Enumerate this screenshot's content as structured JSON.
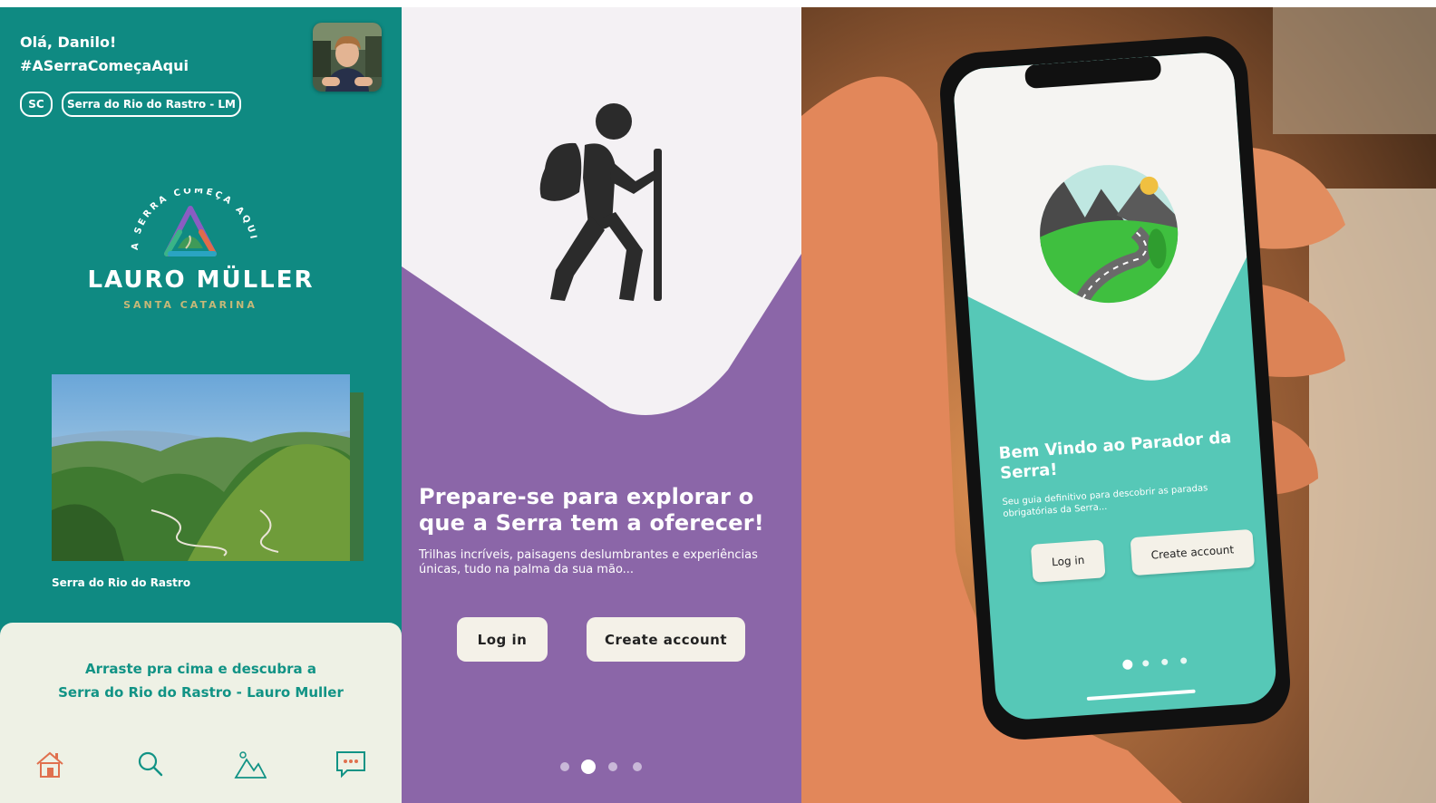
{
  "panel1": {
    "greeting": "Olá, Danilo!",
    "hashtag": "#ASerraComeçaAqui",
    "state_chip": "SC",
    "location_chip": "Serra do Rio do Rastro - LM",
    "logo": {
      "arc_text": "A SERRA COMEÇA AQUI",
      "name": "LAURO MÜLLER",
      "subtitle": "SANTA CATARINA"
    },
    "photo_caption": "Serra do Rio do Rastro",
    "sheet_line1": "Arraste pra cima e descubra a",
    "sheet_line2": "Serra do Rio do Rastro - Lauro Muller",
    "nav_icons": [
      "cabin-icon",
      "search-icon",
      "mountains-sun-icon",
      "chat-icon"
    ]
  },
  "panel2": {
    "title": "Prepare-se para explorar o que a Serra tem a oferecer!",
    "subtitle": "Trilhas incríveis, paisagens deslumbrantes e experiências únicas, tudo na palma da sua mão...",
    "login_label": "Log in",
    "create_label": "Create account",
    "active_dot": 1
  },
  "panel3": {
    "title": "Bem Vindo ao Parador da Serra!",
    "subtitle": "Seu guia definitivo para descobrir as paradas obrigatórias da Serra...",
    "login_label": "Log in",
    "create_label": "Create account",
    "active_dot": 0
  },
  "colors": {
    "teal": "#0f8a82",
    "purple": "#8b66a8",
    "mint": "#56c8b7",
    "cream": "#f4f1e8",
    "sheet_text": "#119385"
  }
}
